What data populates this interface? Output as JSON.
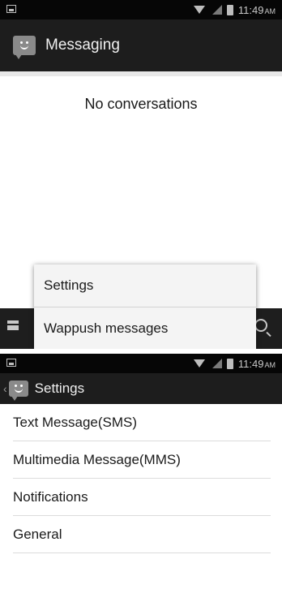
{
  "status_bar": {
    "time": "11:49",
    "ampm": "AM"
  },
  "messaging_screen": {
    "title": "Messaging",
    "empty_text": "No conversations",
    "menu": {
      "items": [
        {
          "label": "Settings"
        },
        {
          "label": "Wappush messages"
        }
      ]
    }
  },
  "settings_screen": {
    "title": "Settings",
    "items": [
      {
        "label": "Text Message(SMS)"
      },
      {
        "label": "Multimedia Message(MMS)"
      },
      {
        "label": "Notifications"
      },
      {
        "label": "General"
      }
    ]
  },
  "icons": [
    "image-notification-icon",
    "wifi-icon",
    "signal-icon",
    "battery-icon",
    "messaging-app-icon",
    "compose-icon",
    "search-icon",
    "back-icon"
  ],
  "colors": {
    "status_bar": "#060606",
    "action_bar": "#1d1d1d",
    "background": "#ffffff",
    "menu": "#f4f4f4"
  }
}
